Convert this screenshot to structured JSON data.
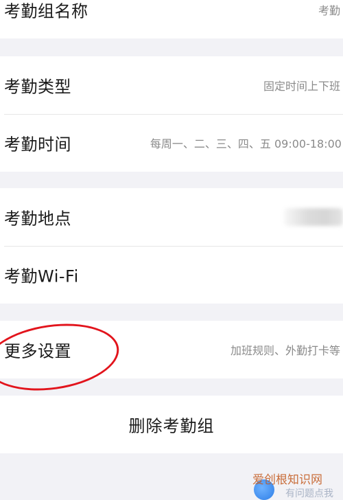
{
  "group1": {
    "name_label": "考勤组名称",
    "name_value": "考勤"
  },
  "group2": {
    "type_label": "考勤类型",
    "type_value": "固定时间上下班",
    "time_label": "考勤时间",
    "time_value": "每周一、二、三、四、五 09:00-18:00"
  },
  "group3": {
    "location_label": "考勤地点",
    "wifi_label": "考勤Wi-Fi"
  },
  "group4": {
    "more_label": "更多设置",
    "more_value": "加班规则、外勤打卡等"
  },
  "delete_label": "删除考勤组",
  "watermark": {
    "title": "爱创根知识网",
    "subtitle": "有问题点我"
  },
  "colors": {
    "background": "#f2f2f6",
    "highlight": "#e2141c"
  }
}
